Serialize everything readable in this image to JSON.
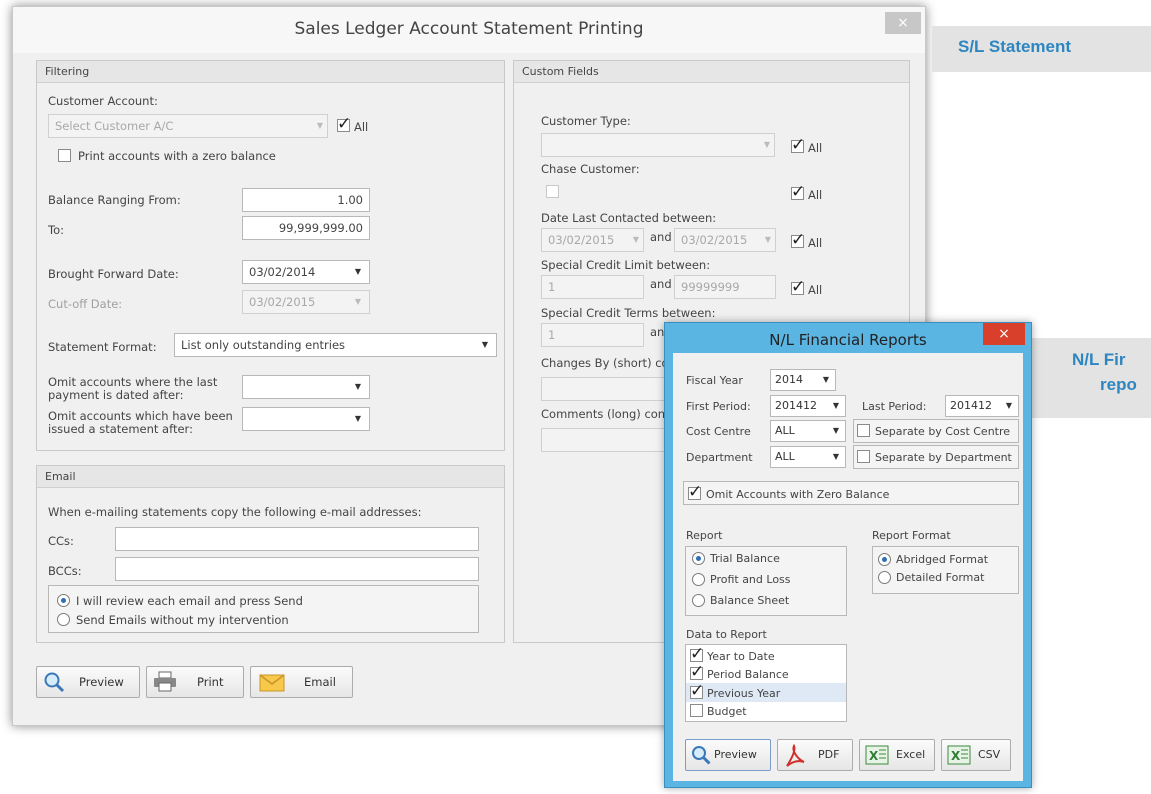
{
  "main_window": {
    "title": "Sales Ledger Account Statement Printing",
    "close_glyph": "×",
    "filtering": {
      "header": "Filtering",
      "customer_account_label": "Customer Account:",
      "customer_account_placeholder": "Select Customer A/C",
      "all_label": "All",
      "print_zero_balance_label": "Print accounts with a zero balance",
      "balance_from_label": "Balance Ranging From:",
      "balance_from_value": "1.00",
      "to_label": "To:",
      "to_value": "99,999,999.00",
      "brought_forward_label": "Brought Forward Date:",
      "brought_forward_value": "03/02/2014",
      "cutoff_label": "Cut-off Date:",
      "cutoff_value": "03/02/2015",
      "statement_format_label": "Statement Format:",
      "statement_format_value": "List only outstanding entries",
      "omit_payment_label_1": "Omit accounts where the last",
      "omit_payment_label_2": "payment is dated after:",
      "omit_statement_label_1": "Omit accounts which have been",
      "omit_statement_label_2": "issued a statement after:"
    },
    "email": {
      "header": "Email",
      "copy_text": "When e-mailing statements copy the following e-mail addresses:",
      "ccs_label": "CCs:",
      "bccs_label": "BCCs:",
      "option_review": "I will review each email and press Send",
      "option_send": "Send Emails without my intervention"
    },
    "custom_fields": {
      "header": "Custom Fields",
      "customer_type_label": "Customer Type:",
      "chase_customer_label": "Chase Customer:",
      "date_last_contacted_label": "Date Last Contacted between:",
      "date_from": "03/02/2015",
      "and_label": "and",
      "date_to": "03/02/2015",
      "special_credit_limit_label": "Special Credit Limit between:",
      "credit_limit_from": "1",
      "credit_limit_to": "99999999",
      "special_credit_terms_label": "Special Credit Terms between:",
      "credit_terms_from": "1",
      "changes_by_label": "Changes By (short) co",
      "comments_label": "Comments (long) cont",
      "all_label": "All"
    },
    "buttons": {
      "preview": "Preview",
      "print": "Print",
      "email": "Email"
    }
  },
  "side_labels": {
    "sl_statement": "S/L Statement",
    "nl_fin_1": "N/L Fir",
    "nl_fin_2": "repo"
  },
  "nl_window": {
    "title": "N/L Financial Reports",
    "close_glyph": "×",
    "fiscal_year_label": "Fiscal Year",
    "fiscal_year_value": "2014",
    "first_period_label": "First Period:",
    "first_period_value": "201412",
    "last_period_label": "Last Period:",
    "last_period_value": "201412",
    "cost_centre_label": "Cost Centre",
    "cost_centre_value": "ALL",
    "separate_cost_centre_label": "Separate by Cost Centre",
    "department_label": "Department",
    "department_value": "ALL",
    "separate_department_label": "Separate by Department",
    "omit_zero_label": "Omit Accounts with Zero Balance",
    "report_header": "Report",
    "report_options": [
      "Trial Balance",
      "Profit and Loss",
      "Balance Sheet"
    ],
    "report_format_header": "Report Format",
    "format_options": [
      "Abridged Format",
      "Detailed Format"
    ],
    "data_to_report_header": "Data to Report",
    "data_options": [
      "Year to Date",
      "Period Balance",
      "Previous Year",
      "Budget"
    ],
    "buttons": {
      "preview": "Preview",
      "pdf": "PDF",
      "excel": "Excel",
      "csv": "CSV"
    }
  },
  "colors": {
    "accent_blue": "#2e86c1",
    "nl_frame": "#5bb5e2",
    "nl_close": "#d9402c"
  }
}
